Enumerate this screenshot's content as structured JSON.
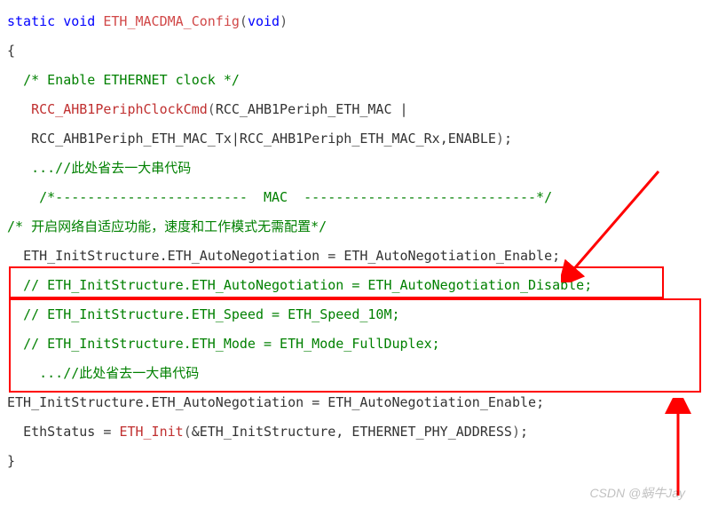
{
  "code": {
    "l1_static": "static",
    "l1_void1": "void",
    "l1_func": "ETH_MACDMA_Config",
    "l1_void2": "void",
    "l2_brace": "{",
    "l3_comment": "/* Enable ETHERNET clock */",
    "l4_func": "RCC_AHB1PeriphClockCmd",
    "l4_arg1": "RCC_AHB1Periph_ETH_MAC",
    "l4_pipe": "|",
    "l5_arg2": "RCC_AHB1Periph_ETH_MAC_Tx",
    "l5_pipe": "|",
    "l5_arg3": "RCC_AHB1Periph_ETH_MAC_Rx",
    "l5_arg4": "ENABLE",
    "l6_comment": "...//此处省去一大串代码",
    "l7_comment": "/*------------------------  MAC  -----------------------------*/",
    "l8_comment": "/* 开启网络自适应功能，速度和工作模式无需配置*/",
    "l9_struct": "ETH_InitStructure",
    "l9_field": "ETH_AutoNegotiation",
    "l9_val": "ETH_AutoNegotiation_Enable",
    "l10_comment": "// ETH_InitStructure.ETH_AutoNegotiation = ETH_AutoNegotiation_Disable;",
    "l11_comment": "// ETH_InitStructure.ETH_Speed = ETH_Speed_10M;",
    "l12_comment": "// ETH_InitStructure.ETH_Mode = ETH_Mode_FullDuplex;",
    "l13_comment": "...//此处省去一大串代码",
    "l14_struct": "ETH_InitStructure",
    "l14_field": "ETH_AutoNegotiation",
    "l14_val": "ETH_AutoNegotiation_Enable",
    "l15_var": "EthStatus",
    "l15_func": "ETH_Init",
    "l15_arg1": "ETH_InitStructure",
    "l15_arg2": "ETHERNET_PHY_ADDRESS",
    "l16_brace": "}"
  },
  "watermark": "CSDN @蜗牛Jay"
}
